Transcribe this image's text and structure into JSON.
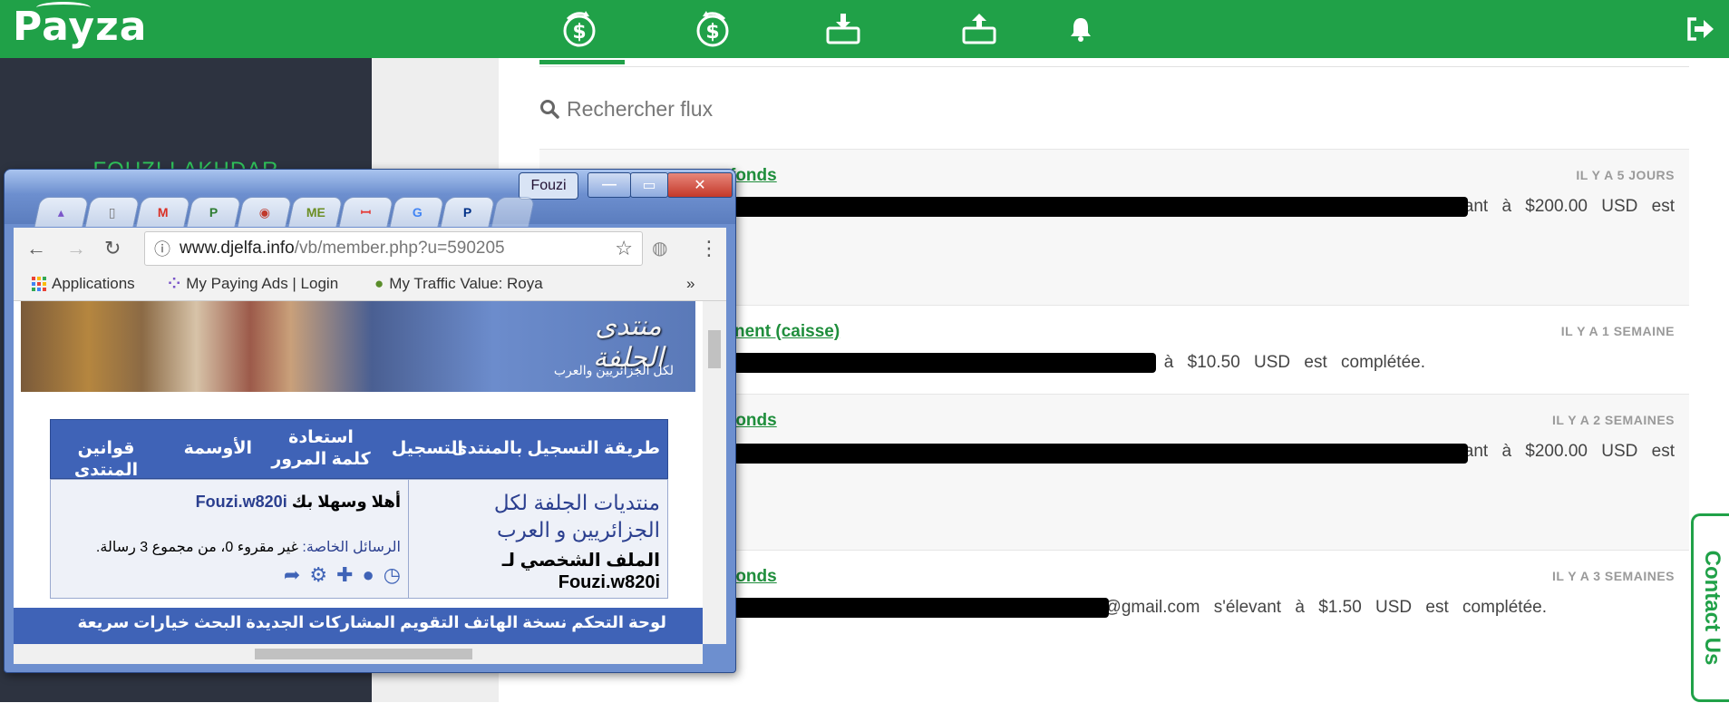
{
  "brand": {
    "logo": "Payza"
  },
  "topnav": {
    "icons": [
      "send-money-icon",
      "request-money-icon",
      "deposit-icon",
      "withdraw-icon",
      "bell-icon",
      "logout-icon"
    ]
  },
  "sidebar": {
    "user_name": "FOUZI LAKHDAR"
  },
  "feed": {
    "search_placeholder": "Rechercher flux",
    "items": [
      {
        "title": "fonds",
        "time": "IL Y A 5 JOURS",
        "text": "@gmail.com  s'élevant  à  $200.00  USD  est"
      },
      {
        "title": "nent (caisse)",
        "time": "IL Y A 1 SEMAINE",
        "text": "@gmail.com s'élevant à $10.50 USD est complétée."
      },
      {
        "title": "fonds",
        "time": "IL Y A 2 SEMAINES",
        "text": "@gmail.com  s'élevant  à  $200.00  USD  est"
      },
      {
        "title": "fonds",
        "time": "IL Y A 3 SEMAINES",
        "text": "@gmail.com s'élevant à $1.50 USD est complétée."
      }
    ]
  },
  "contact_tab": "Contact Us",
  "browser": {
    "profile": "Fouzi",
    "url_host": "www.djelfa.info",
    "url_path": "/vb/member.php?u=590205",
    "tabs": [
      "▴",
      "▯",
      "M",
      "P",
      "◉",
      "ME",
      "ꟷ",
      "G",
      "P",
      ""
    ],
    "bookmarks": {
      "apps": "Applications",
      "bm1": "My Paying Ads | Login",
      "bm2": "My Traffic Value: Roya",
      "more": "»"
    },
    "page": {
      "banner_logo": "منتدى الجلفة",
      "banner_tag": "لكل الجزائريين والعرب",
      "nav": [
        "طريقة التسجيل بالمنتدى",
        "التسجيل",
        "استعادة كلمة المرور",
        "الأوسمة",
        "قوانين المنتدى"
      ],
      "forum_title": "منتديات الجلفة لكل الجزائريين و العرب",
      "profile_label": "الملف الشخصي لـ",
      "profile_user": "Fouzi.w820i",
      "welcome_prefix": "أهلا وسهلا بك",
      "welcome_user": "Fouzi.w820i",
      "pm_label": "الرسائل الخاصة:",
      "pm_text": "غير مقروء 0، من مجموع 3 رسالة.",
      "bottom_nav": "لوحة التحكم   نسخة الهاتف   التقويم   المشاركات الجديدة   البحث   خيارات سريعة"
    }
  }
}
